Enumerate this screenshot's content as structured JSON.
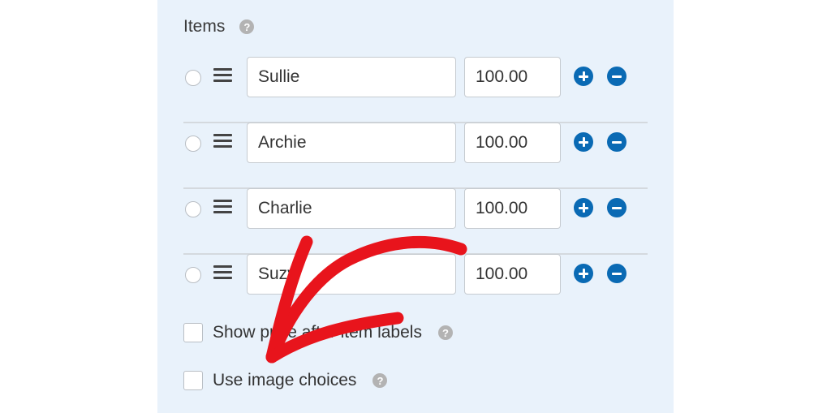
{
  "items_header": {
    "title": "Items",
    "help_icon": "?"
  },
  "items": [
    {
      "label": "Sullie",
      "price": "100.00"
    },
    {
      "label": "Archie",
      "price": "100.00"
    },
    {
      "label": "Charlie",
      "price": "100.00"
    },
    {
      "label": "Suzy",
      "price": "100.00"
    }
  ],
  "options": {
    "show_price_label": "Show price after item labels",
    "use_image_choices": "Use image choices",
    "help_icon": "?"
  },
  "annotation": {
    "arrow_color": "#e8141c"
  },
  "colors": {
    "panel_bg": "#e9f2fb",
    "accent": "#0a6ab4"
  }
}
